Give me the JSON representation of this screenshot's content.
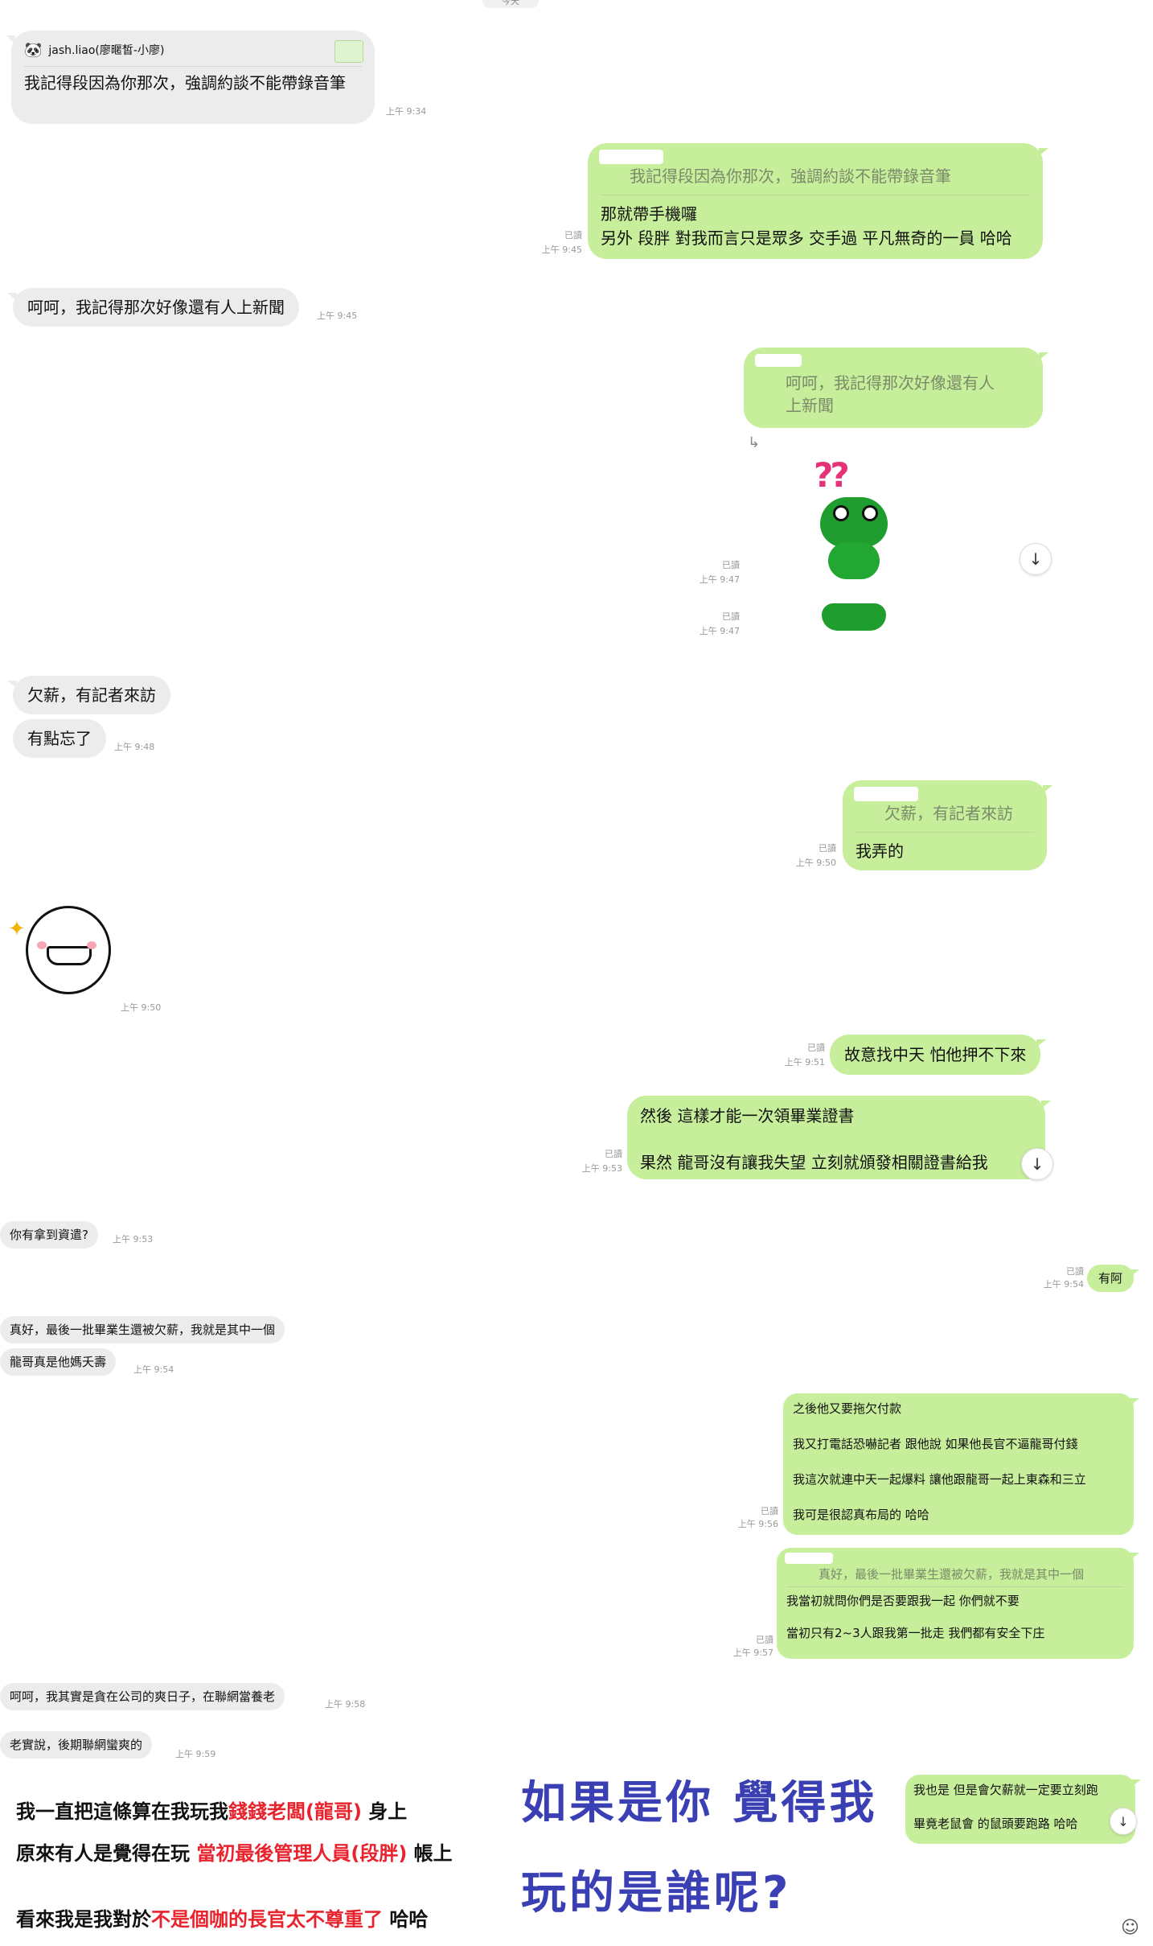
{
  "date_divider": "今天",
  "messages": {
    "m1": {
      "sender": "jash.liao(廖暱皙-小廖)",
      "text": "我記得段因為你那次，強調約談不能帶錄音筆",
      "time": "上午 9:34"
    },
    "m2": {
      "quote": "我記得段因為你那次，強調約談不能帶錄音筆",
      "line1": "那就帶手機囉",
      "line2": "另外 段胖 對我而言只是眾多 交手過 平凡無奇的一員 哈哈",
      "read": "已讀",
      "time": "上午 9:45"
    },
    "m3": {
      "text": "呵呵，我記得那次好像還有人上新聞",
      "time": "上午 9:45"
    },
    "m4": {
      "quote_line1": "呵呵，我記得那次好像還有人",
      "quote_line2": "上新聞",
      "reply_icon": "↳",
      "read": "已讀",
      "time": "上午 9:47",
      "sticker_text": "??"
    },
    "m5": {
      "read": "已讀",
      "time": "上午 9:47"
    },
    "m6": {
      "text": "欠薪，有記者來訪"
    },
    "m7": {
      "text": "有點忘了",
      "time": "上午 9:48"
    },
    "m8": {
      "quote": "欠薪，有記者來訪",
      "text": "我弄的",
      "read": "已讀",
      "time": "上午 9:50"
    },
    "m9": {
      "time": "上午 9:50"
    },
    "m10": {
      "text": "故意找中天 怕他押不下來",
      "read": "已讀",
      "time": "上午 9:51"
    },
    "m11": {
      "line1": "然後 這樣才能一次領畢業證書",
      "line2": "果然 龍哥沒有讓我失望 立刻就頒發相關證書給我",
      "read": "已讀",
      "time": "上午 9:53"
    },
    "m12": {
      "text": "你有拿到資遣?",
      "time": "上午 9:53"
    },
    "m13": {
      "text": "有阿",
      "read": "已讀",
      "time": "上午 9:54"
    },
    "m14": {
      "text": "真好，最後一批畢業生還被欠薪，我就是其中一個"
    },
    "m15": {
      "text": "龍哥真是他媽夭壽",
      "time": "上午 9:54"
    },
    "m16": {
      "l1": "之後他又要拖欠付款",
      "l2": "我又打電話恐嚇記者 跟他說 如果他長官不逼龍哥付錢",
      "l3": "我這次就連中天一起爆料 讓他跟龍哥一起上東森和三立",
      "l4": "我可是很認真布局的 哈哈",
      "read": "已讀",
      "time": "上午 9:56"
    },
    "m17": {
      "quote": "真好，最後一批畢業生還被欠薪，我就是其中一個",
      "l1": "我當初就問你們是否要跟我一起 你們就不要",
      "l2": "當初只有2~3人跟我第一批走 我們都有安全下庄",
      "read": "已讀",
      "time": "上午 9:57"
    },
    "m18": {
      "text": "呵呵，我其實是貪在公司的爽日子，在聯網當養老",
      "time": "上午 9:58"
    },
    "m19": {
      "text": "老實說，後期聯網蠻爽的",
      "time": "上午 9:59"
    },
    "m20": {
      "l1": "我也是 但是會欠薪就一定要立刻跑",
      "l2": "畢竟老鼠會 的鼠頭要跑路 哈哈",
      "read": "已讀"
    }
  },
  "annotation": {
    "line1_a": "我一直把這條算在我玩我",
    "line1_red": "錢錢老闆(龍哥)",
    "line1_b": " 身上",
    "line2_a": "原來有人是覺得在玩 ",
    "line2_red": "當初最後管理人員(段胖)",
    "line2_b": " 帳上",
    "line3_a": "看來我是我對於",
    "line3_red": "不是個咖的長官太不尊重了",
    "line3_b": " 哈哈"
  },
  "question": {
    "line1": "如果是你 覺得我",
    "line2": "玩的是誰呢?"
  },
  "icons": {
    "scroll_down": "↓",
    "emoji": "☺"
  },
  "colors": {
    "incoming": "#ececec",
    "outgoing": "#c7ee9a",
    "question": "#3a3fb4",
    "highlight": "#e8232d"
  }
}
